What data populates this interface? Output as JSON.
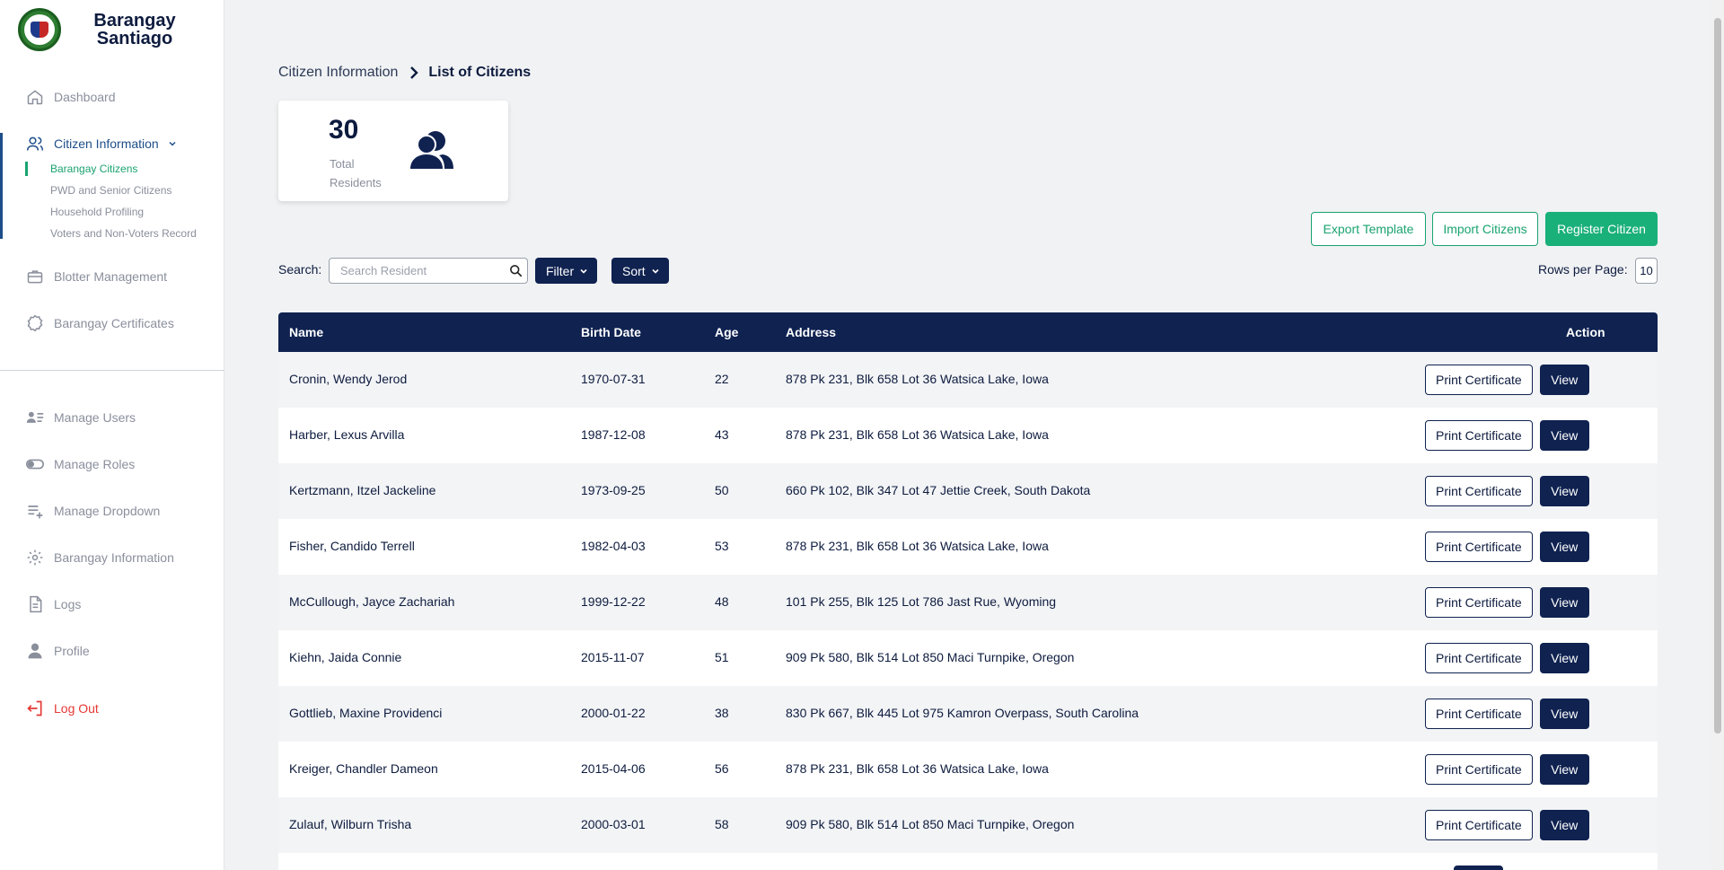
{
  "sidebar": {
    "brand": {
      "line1": "Barangay",
      "line2": "Santiago"
    },
    "items": [
      {
        "label": "Dashboard",
        "icon": "home-icon"
      },
      {
        "label": "Citizen Information",
        "icon": "users-icon"
      },
      {
        "label": "Blotter Management",
        "icon": "briefcase-icon"
      },
      {
        "label": "Barangay Certificates",
        "icon": "badge-icon"
      },
      {
        "label": "Manage Users",
        "icon": "user-list-icon"
      },
      {
        "label": "Manage Roles",
        "icon": "toggle-icon"
      },
      {
        "label": "Manage Dropdown",
        "icon": "list-add-icon"
      },
      {
        "label": "Barangay Information",
        "icon": "gear-icon"
      },
      {
        "label": "Logs",
        "icon": "document-icon"
      },
      {
        "label": "Profile",
        "icon": "person-icon"
      },
      {
        "label": "Log Out",
        "icon": "logout-icon"
      }
    ],
    "sub_items": [
      {
        "label": "Barangay Citizens"
      },
      {
        "label": "PWD and Senior Citizens"
      },
      {
        "label": "Household Profiling"
      },
      {
        "label": "Voters and Non-Voters Record"
      }
    ]
  },
  "breadcrumb": {
    "parent": "Citizen Information",
    "current": "List of Citizens"
  },
  "stats": {
    "total": "30",
    "label": "Total Residents"
  },
  "actions": {
    "export": "Export Template",
    "import": "Import Citizens",
    "register": "Register Citizen"
  },
  "search": {
    "label": "Search:",
    "placeholder": "Search Resident"
  },
  "filter_label": "Filter",
  "sort_label": "Sort",
  "rows_per_page": {
    "label": "Rows per Page:",
    "value": "10"
  },
  "table": {
    "headers": {
      "name": "Name",
      "birth": "Birth Date",
      "age": "Age",
      "address": "Address",
      "action": "Action"
    },
    "print_label": "Print Certificate",
    "view_label": "View",
    "rows": [
      {
        "name": "Cronin, Wendy Jerod",
        "birth": "1970-07-31",
        "age": "22",
        "address": "878 Pk 231, Blk 658 Lot 36 Watsica Lake, Iowa"
      },
      {
        "name": "Harber, Lexus Arvilla",
        "birth": "1987-12-08",
        "age": "43",
        "address": "878 Pk 231, Blk 658 Lot 36 Watsica Lake, Iowa"
      },
      {
        "name": "Kertzmann, Itzel Jackeline",
        "birth": "1973-09-25",
        "age": "50",
        "address": "660 Pk 102, Blk 347 Lot 47 Jettie Creek, South Dakota"
      },
      {
        "name": "Fisher, Candido Terrell",
        "birth": "1982-04-03",
        "age": "53",
        "address": "878 Pk 231, Blk 658 Lot 36 Watsica Lake, Iowa"
      },
      {
        "name": "McCullough, Jayce Zachariah",
        "birth": "1999-12-22",
        "age": "48",
        "address": "101 Pk 255, Blk 125 Lot 786 Jast Rue, Wyoming"
      },
      {
        "name": "Kiehn, Jaida Connie",
        "birth": "2015-11-07",
        "age": "51",
        "address": "909 Pk 580, Blk 514 Lot 850 Maci Turnpike, Oregon"
      },
      {
        "name": "Gottlieb, Maxine Providenci",
        "birth": "2000-01-22",
        "age": "38",
        "address": "830 Pk 667, Blk 445 Lot 975 Kamron Overpass, South Carolina"
      },
      {
        "name": "Kreiger, Chandler Dameon",
        "birth": "2015-04-06",
        "age": "56",
        "address": "878 Pk 231, Blk 658 Lot 36 Watsica Lake, Iowa"
      },
      {
        "name": "Zulauf, Wilburn Trisha",
        "birth": "2000-03-01",
        "age": "58",
        "address": "909 Pk 580, Blk 514 Lot 850 Maci Turnpike, Oregon"
      }
    ]
  },
  "colors": {
    "navy": "#0f2250",
    "green": "#1ab07a",
    "active_blue": "#1d4e89",
    "logout_red": "#e53935"
  }
}
